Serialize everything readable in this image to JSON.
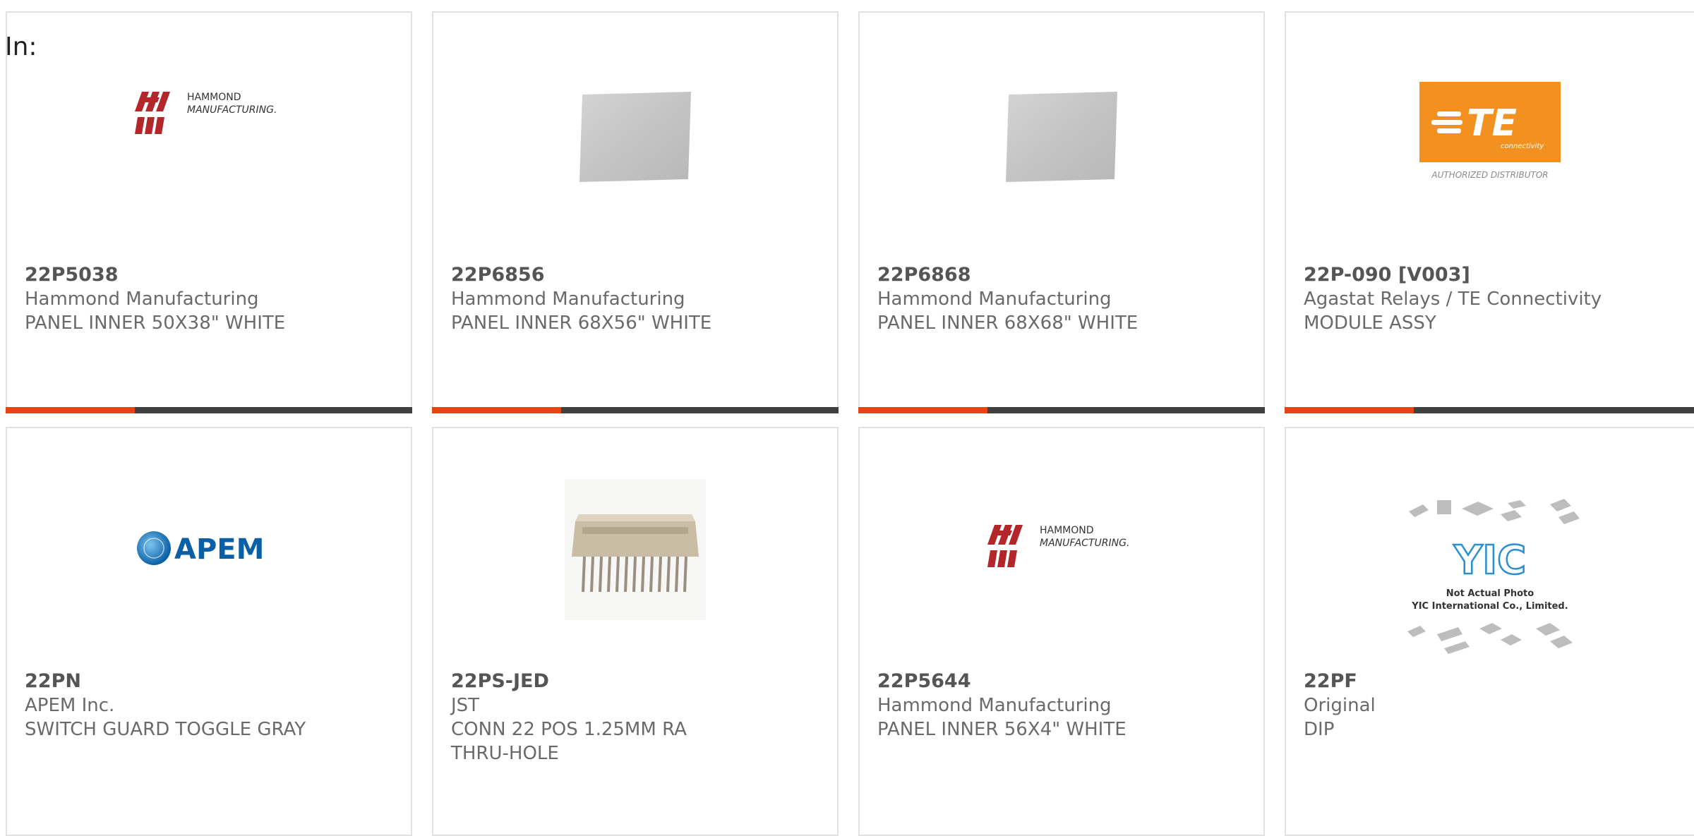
{
  "filter": {
    "in_label": "In:"
  },
  "cards": [
    {
      "part_number": "22P5038",
      "manufacturer": "Hammond Manufacturing",
      "description": "PANEL INNER 50X38\" WHITE",
      "image": "hammond-logo"
    },
    {
      "part_number": "22P6856",
      "manufacturer": "Hammond Manufacturing",
      "description": "PANEL INNER 68X56\" WHITE",
      "image": "panel-photo"
    },
    {
      "part_number": "22P6868",
      "manufacturer": "Hammond Manufacturing",
      "description": "PANEL INNER 68X68\" WHITE",
      "image": "panel-photo"
    },
    {
      "part_number": "22P-090 [V003]",
      "manufacturer": "Agastat Relays / TE Connectivity",
      "description": "MODULE ASSY",
      "image": "te-logo"
    },
    {
      "part_number": "22PN",
      "manufacturer": "APEM Inc.",
      "description": "SWITCH GUARD TOGGLE GRAY",
      "image": "apem-logo"
    },
    {
      "part_number": "22PS-JED",
      "manufacturer": "JST",
      "description": "CONN 22 POS 1.25MM RA THRU-HOLE",
      "image": "connector-photo"
    },
    {
      "part_number": "22P5644",
      "manufacturer": "Hammond Manufacturing",
      "description": "PANEL INNER 56X4\" WHITE",
      "image": "hammond-logo"
    },
    {
      "part_number": "22PF",
      "manufacturer": "Original",
      "description": "DIP",
      "image": "yic-placeholder"
    }
  ],
  "logos": {
    "hammond_line1": "HAMMOND",
    "hammond_line2": "MANUFACTURING.",
    "te_sub": "connectivity",
    "te_tag": "AUTHORIZED DISTRIBUTOR",
    "te_text": "TE",
    "apem_text": "APEM",
    "yic_text": "YIC",
    "yic_line1": "Not Actual Photo",
    "yic_line2": "YIC International Co., Limited."
  },
  "colors": {
    "accent": "#e64415",
    "bar_dark": "#404040",
    "hammond_red": "#b3262a",
    "te_orange": "#f39120",
    "apem_blue": "#0b5fa5"
  }
}
